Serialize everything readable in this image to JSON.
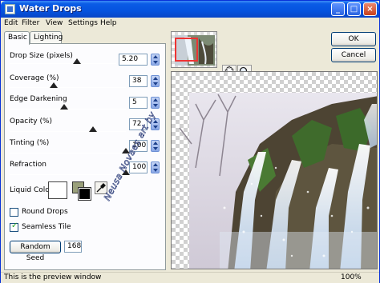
{
  "window": {
    "title": "Water Drops"
  },
  "menu": [
    "Edit",
    "Filter",
    "View",
    "Settings",
    "Help"
  ],
  "tabs": [
    "Basic",
    "Lighting"
  ],
  "controls": {
    "drop_size": {
      "label": "Drop Size (pixels)",
      "value": "5.20",
      "level": 0.63
    },
    "coverage": {
      "label": "Coverage (%)",
      "value": "38",
      "level": 0.38
    },
    "edge_darkening": {
      "label": "Edge Darkening",
      "value": "5",
      "level": 0.47
    },
    "opacity": {
      "label": "Opacity (%)",
      "value": "72",
      "level": 0.72
    },
    "tinting": {
      "label": "Tinting (%)",
      "value": "100",
      "level": 1.0
    },
    "refraction": {
      "label": "Refraction",
      "value": "100",
      "level": 1.0
    }
  },
  "liquid_color": {
    "label": "Liquid Color",
    "color": "#ffffff"
  },
  "round_drops": {
    "label": "Round Drops",
    "checked": false
  },
  "seamless_tile": {
    "label": "Seamless Tile",
    "checked": true
  },
  "random_seed": {
    "label": "Random Seed",
    "value": "168"
  },
  "buttons": {
    "ok": "OK",
    "cancel": "Cancel"
  },
  "watermark": "Neusa Novaes art by",
  "status": {
    "text": "This is the preview window",
    "zoom": "100%"
  },
  "colors": {
    "title_bar": "#0553df",
    "face": "#ece9d8",
    "panel": "#fcfcfe"
  },
  "icons": [
    "hand-icon",
    "magnifier-icon",
    "eyedropper-icon"
  ]
}
